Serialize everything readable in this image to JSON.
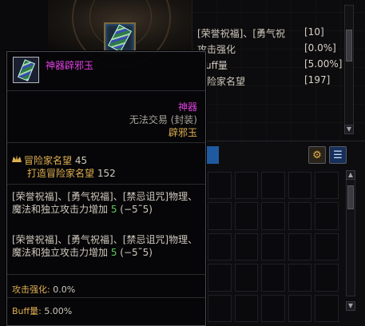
{
  "background": {
    "stats_panel": {
      "rows": [
        {
          "label": "[荣誉祝福]、[勇气祝",
          "value": "[10]"
        },
        {
          "label": "攻击强化",
          "value": "[0.0%]"
        },
        {
          "label": "uff量",
          "value": "[5.00%]"
        },
        {
          "label": "险家名望",
          "value": "[197]"
        }
      ]
    },
    "inventory": {
      "settings_icon": "gear-icon",
      "list_icon": "list-icon"
    }
  },
  "tooltip": {
    "name": "神器辟邪玉",
    "rarity": "神器",
    "trade": "无法交易 (封装)",
    "set_name": "辟邪玉",
    "fame": {
      "label": "冒险家名望",
      "value": "45"
    },
    "forge_fame": {
      "label": "打造冒险家名望",
      "value": "152"
    },
    "effects": [
      {
        "pre": "[荣誉祝福]、[勇气祝福]、[禁忌诅咒]物理、魔法和独立攻击力增加 ",
        "num": "5",
        "post": " (−5˜5)"
      },
      {
        "pre": "[荣誉祝福]、[勇气祝福]、[禁忌诅咒]物理、魔法和独立攻击力增加 ",
        "num": "5",
        "post": " (−5˜5)"
      }
    ],
    "attack_enhance": {
      "label": "攻击强化:",
      "value": "0.0%"
    },
    "buff_amount": {
      "label": "Buff量:",
      "value": "5.00%"
    }
  },
  "colors": {
    "epic_name": "#e040e0",
    "gold_text": "#e0b050",
    "green_value": "#5ec85e",
    "inventory_tab": "#1f5aa0"
  }
}
